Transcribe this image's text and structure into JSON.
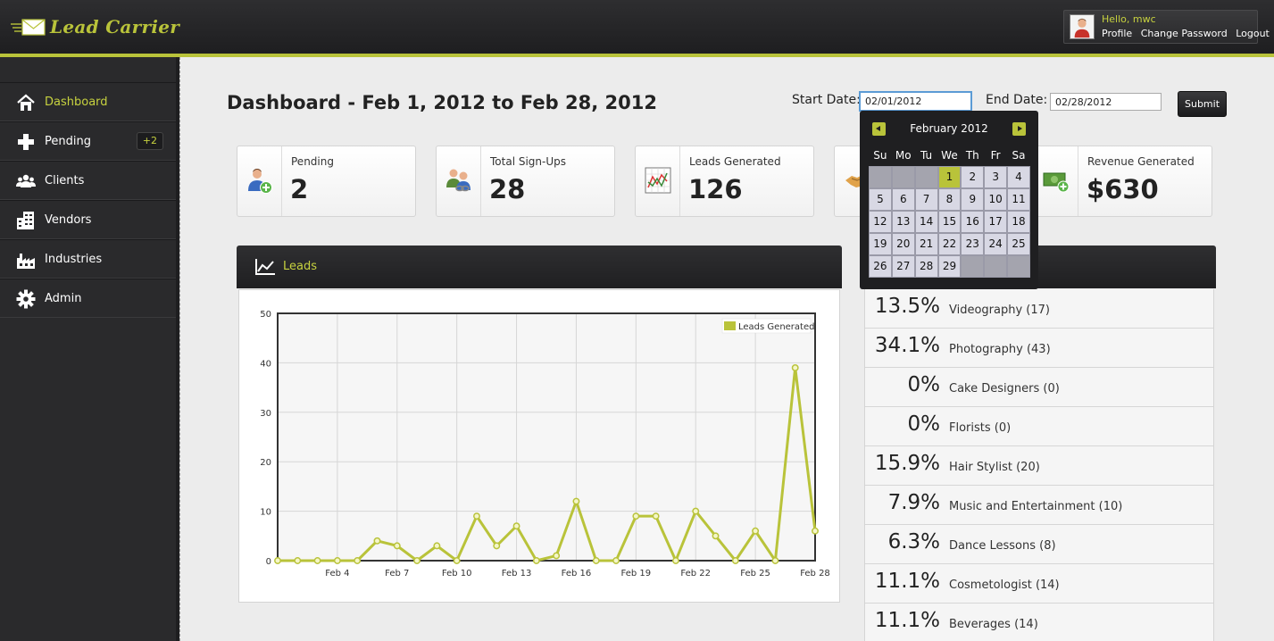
{
  "header": {
    "logo_text": "Lead Carrier",
    "greeting": "Hello, mwc",
    "links": [
      "Profile",
      "Change Password",
      "Logout"
    ]
  },
  "sidebar": {
    "items": [
      {
        "label": "Dashboard",
        "icon": "home-icon",
        "active": true
      },
      {
        "label": "Pending",
        "icon": "plus-icon",
        "badge": "+2"
      },
      {
        "label": "Clients",
        "icon": "people-icon"
      },
      {
        "label": "Vendors",
        "icon": "building-icon"
      },
      {
        "label": "Industries",
        "icon": "factory-icon"
      },
      {
        "label": "Admin",
        "icon": "gear-icon"
      }
    ]
  },
  "main": {
    "title": "Dashboard - Feb 1, 2012 to Feb 28, 2012",
    "start_label": "Start Date:",
    "start_value": "02/01/2012",
    "end_label": "End Date:",
    "end_value": "02/28/2012",
    "submit_label": "Submit"
  },
  "stats": [
    {
      "label": "Pending",
      "value": "2",
      "icon": "user-add-icon"
    },
    {
      "label": "Total Sign-Ups",
      "value": "28",
      "icon": "users-link-icon"
    },
    {
      "label": "Leads Generated",
      "value": "126",
      "icon": "chart-icon"
    },
    {
      "label": "",
      "value": "",
      "icon": "handshake-icon"
    },
    {
      "label": "Revenue Generated",
      "value": "$630",
      "icon": "money-add-icon"
    }
  ],
  "leads_panel": {
    "title": "Leads"
  },
  "chart_data": {
    "type": "line",
    "x": [
      "Feb 1",
      "Feb 2",
      "Feb 3",
      "Feb 4",
      "Feb 5",
      "Feb 6",
      "Feb 7",
      "Feb 8",
      "Feb 9",
      "Feb 10",
      "Feb 11",
      "Feb 12",
      "Feb 13",
      "Feb 14",
      "Feb 15",
      "Feb 16",
      "Feb 17",
      "Feb 18",
      "Feb 19",
      "Feb 20",
      "Feb 21",
      "Feb 22",
      "Feb 23",
      "Feb 24",
      "Feb 25",
      "Feb 26",
      "Feb 27",
      "Feb 28"
    ],
    "tick_labels": [
      "Feb 4",
      "Feb 7",
      "Feb 10",
      "Feb 13",
      "Feb 16",
      "Feb 19",
      "Feb 22",
      "Feb 25",
      "Feb 28"
    ],
    "series": [
      {
        "name": "Leads Generated",
        "values": [
          0,
          0,
          0,
          0,
          0,
          4,
          3,
          0,
          3,
          0,
          9,
          3,
          7,
          0,
          1,
          12,
          0,
          0,
          9,
          9,
          0,
          10,
          5,
          0,
          6,
          0,
          39,
          6
        ]
      }
    ],
    "ylim": [
      0,
      50
    ],
    "yticks": [
      0,
      10,
      20,
      30,
      40,
      50
    ],
    "grid": true,
    "legend": "top-right",
    "color": "#b9c33a"
  },
  "breakdown": [
    {
      "pct": "13.5%",
      "name": "Videography (17)"
    },
    {
      "pct": "34.1%",
      "name": "Photography (43)"
    },
    {
      "pct": "0%",
      "name": "Cake Designers (0)"
    },
    {
      "pct": "0%",
      "name": "Florists (0)"
    },
    {
      "pct": "15.9%",
      "name": "Hair Stylist (20)"
    },
    {
      "pct": "7.9%",
      "name": "Music and Entertainment (10)"
    },
    {
      "pct": "6.3%",
      "name": "Dance Lessons (8)"
    },
    {
      "pct": "11.1%",
      "name": "Cosmetologist (14)"
    },
    {
      "pct": "11.1%",
      "name": "Beverages (14)"
    }
  ],
  "calendar": {
    "title": "February 2012",
    "dow": [
      "Su",
      "Mo",
      "Tu",
      "We",
      "Th",
      "Fr",
      "Sa"
    ],
    "leading_blank": 3,
    "days": 29,
    "selected": 1
  },
  "colors": {
    "accent": "#b9c33a",
    "dark": "#2a2a2c"
  }
}
